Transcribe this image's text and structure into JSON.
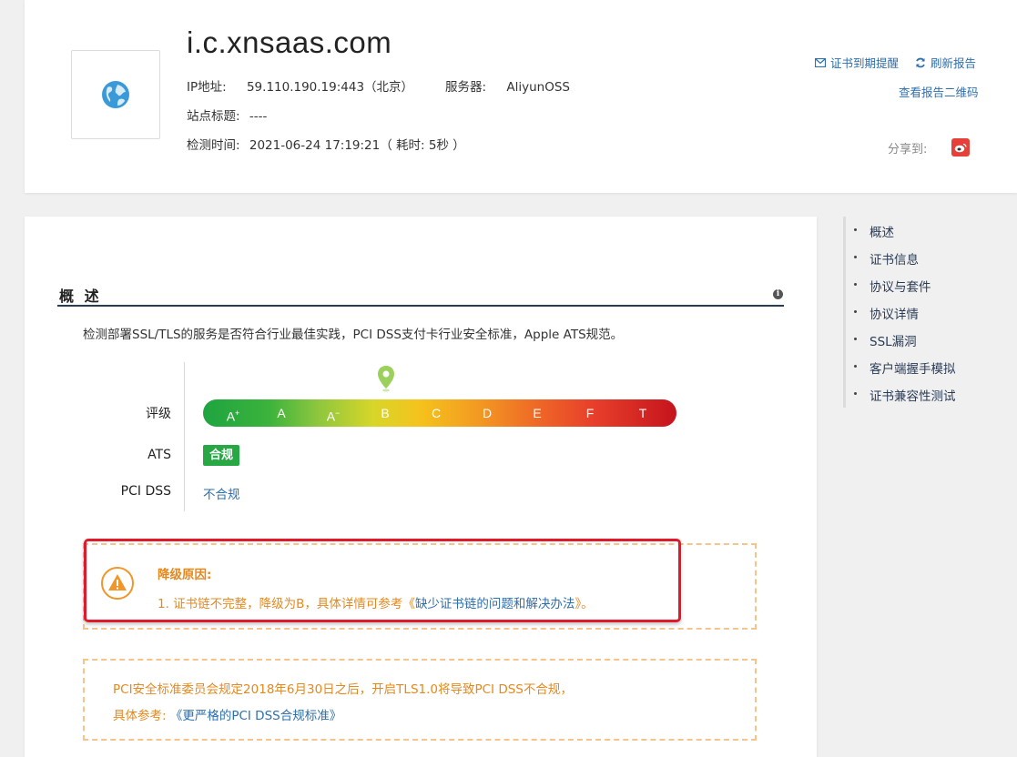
{
  "header": {
    "title": "i.c.xnsaas.com",
    "ip_label": "IP地址:",
    "ip_value": "59.110.190.19:443（北京）",
    "server_label": "服务器:",
    "server_value": "AliyunOSS",
    "site_title_label": "站点标题:",
    "site_title_value": "----",
    "check_time_label": "检测时间:",
    "check_time_value": "2021-06-24 17:19:21（ 耗时: 5秒 ）",
    "cert_reminder": "证书到期提醒",
    "refresh_report": "刷新报告",
    "view_qr": "查看报告二维码",
    "share_label": "分享到:"
  },
  "overview": {
    "title": "概 述",
    "description": "检测部署SSL/TLS的服务是否符合行业最佳实践，PCI DSS支付卡行业安全标准，Apple ATS规范。",
    "rating_label": "评级",
    "grades": [
      "A+",
      "A",
      "A-",
      "B",
      "C",
      "D",
      "E",
      "F",
      "T"
    ],
    "current_grade": "B",
    "ats_label": "ATS",
    "ats_status": "合规",
    "pci_label": "PCI DSS",
    "pci_status": "不合规"
  },
  "downgrade": {
    "title": "降级原因:",
    "text_prefix": "1. 证书链不完整，降级为B，具体详情可参考《",
    "link": "缺少证书链的问题和解决办法",
    "text_suffix": "》。"
  },
  "pci_notice": {
    "line1": "PCI安全标准委员会规定2018年6月30日之后，开启TLS1.0将导致PCI DSS不合规，",
    "line2_prefix": "具体参考: ",
    "link": "《更严格的PCI DSS合规标准》"
  },
  "toc": {
    "items": [
      "概述",
      "证书信息",
      "协议与套件",
      "协议详情",
      "SSL漏洞",
      "客户端握手模拟",
      "证书兼容性测试"
    ]
  },
  "colors": {
    "link": "#2e6fad",
    "warning": "#e5891e",
    "ok_badge": "#28a745",
    "highlight_frame": "#e0192b"
  }
}
